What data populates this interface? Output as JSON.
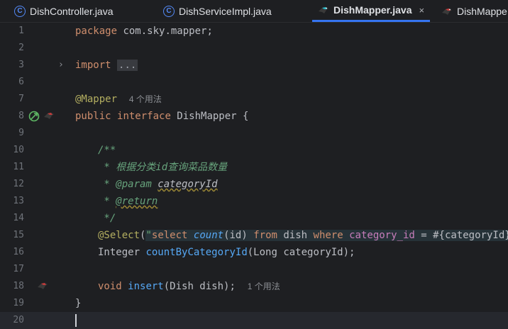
{
  "tabs": [
    {
      "label": "DishController.java",
      "icon": "class-icon"
    },
    {
      "label": "DishServiceImpl.java",
      "icon": "class-icon"
    },
    {
      "label": "DishMapper.java",
      "icon": "mybatis-icon",
      "active": true,
      "close": "×"
    },
    {
      "label": "DishMappe",
      "icon": "mybatis-icon"
    }
  ],
  "lines": {
    "n1": "1",
    "n2": "2",
    "n3": "3",
    "n6": "6",
    "n7": "7",
    "n8": "8",
    "n9": "9",
    "n10": "10",
    "n11": "11",
    "n12": "12",
    "n13": "13",
    "n14": "14",
    "n15": "15",
    "n16": "16",
    "n17": "17",
    "n18": "18",
    "n19": "19",
    "n20": "20"
  },
  "code": {
    "package_kw": "package",
    "package_name": " com.sky.mapper;",
    "import_kw": "import",
    "import_collapsed": "...",
    "mapper_ann": "@Mapper",
    "mapper_hint": "4 个用法",
    "public_kw": "public",
    "interface_kw": "interface",
    "class_name": " DishMapper {",
    "doc_open": "/**",
    "doc_line1": " * 根据分类id查询菜品数量",
    "doc_param_tag": " * @param",
    "doc_param_name": "categoryId",
    "doc_return_prefix": " * ",
    "doc_return_tag": "@return",
    "doc_close": " */",
    "select_ann": "@Select",
    "select_paren_open": "(",
    "sql_quote_open": "\"",
    "sql_select": "select",
    "sql_count": "count",
    "sql_id": "(id)",
    "sql_from": "from",
    "sql_table": " dish ",
    "sql_where": "where",
    "sql_col": "category_id",
    "sql_eq": " = #{categoryId}",
    "sql_quote_close": "\"",
    "select_paren_close": ")",
    "ret_type": "Integer",
    "method1": "countByCategoryId",
    "method1_args": "(Long categoryId);",
    "void_kw": "void",
    "method2": "insert",
    "method2_args": "(Dish dish);",
    "insert_hint": "1 个用法",
    "close_brace": "}"
  }
}
